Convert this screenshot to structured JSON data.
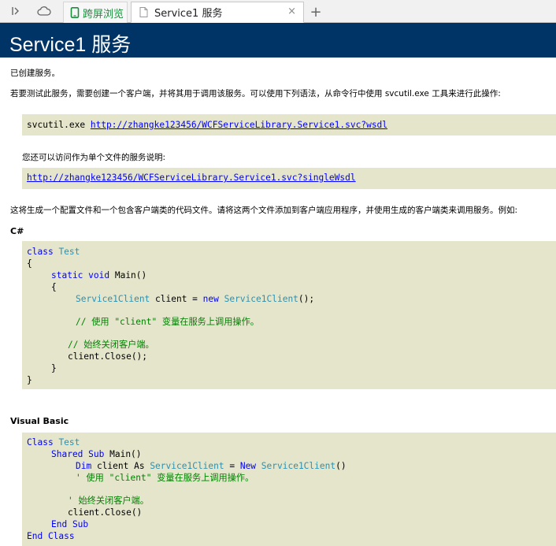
{
  "browser": {
    "green_tab_label": "跨屏浏览",
    "active_tab_title": "Service1 服务",
    "close_glyph": "×",
    "new_tab_glyph": "+"
  },
  "page": {
    "title": "Service1 服务",
    "created": "已创建服务。",
    "intro": "若要测试此服务，需要创建一个客户端，并将其用于调用该服务。可以使用下列语法，从命令行中使用 svcutil.exe 工具来进行此操作:",
    "svcutil_cmd": "svcutil.exe",
    "wsdl_url": "http://zhangke123456/WCFServiceLibrary.Service1.svc?wsdl",
    "single_file_text": "您还可以访问作为单个文件的服务说明:",
    "single_wsdl_url": "http://zhangke123456/WCFServiceLibrary.Service1.svc?singleWsdl",
    "generate_text": "这将生成一个配置文件和一个包含客户端类的代码文件。请将这两个文件添加到客户端应用程序，并使用生成的客户端类来调用服务。例如:",
    "csharp_heading": "C#",
    "vb_heading": "Visual Basic"
  },
  "csharp": {
    "class_kw": "class",
    "class_name": "Test",
    "open_brace": "{",
    "close_brace": "}",
    "static_void": "static void",
    "main": "Main()",
    "client_type": "Service1Client",
    "client_decl": " client = ",
    "new_kw": "new",
    "ctor_end": "();",
    "comment_use": "// 使用 \"client\" 变量在服务上调用操作。",
    "comment_close": "// 始终关闭客户端。",
    "close_call": "client.Close();"
  },
  "vb": {
    "class_kw": "Class",
    "class_name": "Test",
    "shared_sub": "Shared Sub",
    "main": "Main()",
    "dim_kw": "Dim",
    "client_as": " client As ",
    "client_type": "Service1Client",
    "eq": " = ",
    "new_kw": "New",
    "ctor_end": "()",
    "comment_use": "' 使用 \"client\" 变量在服务上调用操作。",
    "comment_close": "' 始终关闭客户端。",
    "close_call": "client.Close()",
    "end_sub": "End Sub",
    "end_class": "End Class"
  }
}
